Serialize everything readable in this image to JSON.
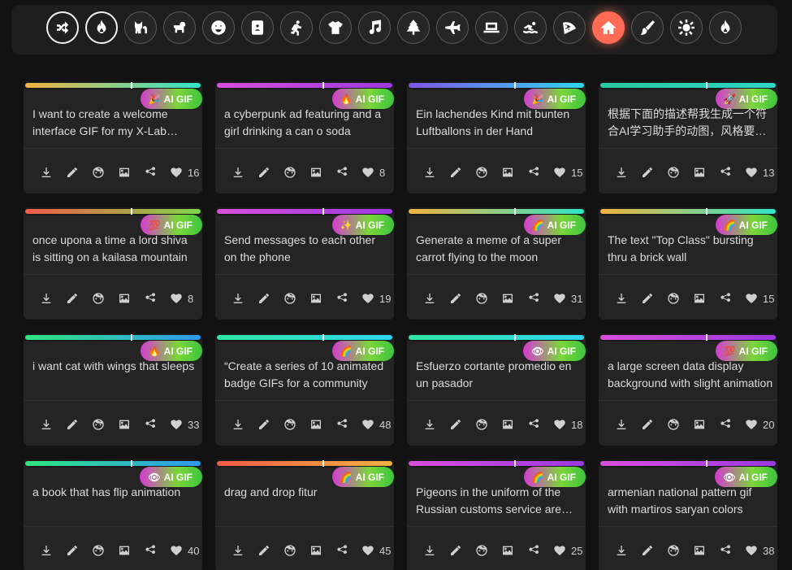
{
  "categories": [
    {
      "icon": "shuffle-icon",
      "state": "selected"
    },
    {
      "icon": "fire-icon",
      "state": "selected"
    },
    {
      "icon": "cat-icon",
      "state": ""
    },
    {
      "icon": "dog-icon",
      "state": ""
    },
    {
      "icon": "smiley-icon",
      "state": ""
    },
    {
      "icon": "contact-card-icon",
      "state": ""
    },
    {
      "icon": "running-person-icon",
      "state": ""
    },
    {
      "icon": "tshirt-icon",
      "state": ""
    },
    {
      "icon": "music-note-icon",
      "state": ""
    },
    {
      "icon": "tree-icon",
      "state": ""
    },
    {
      "icon": "airplane-icon",
      "state": ""
    },
    {
      "icon": "laptop-icon",
      "state": ""
    },
    {
      "icon": "swimmer-icon",
      "state": ""
    },
    {
      "icon": "pizza-icon",
      "state": ""
    },
    {
      "icon": "home-icon",
      "state": "active"
    },
    {
      "icon": "paintbrush-icon",
      "state": ""
    },
    {
      "icon": "sun-icon",
      "state": ""
    },
    {
      "icon": "flame-icon",
      "state": ""
    }
  ],
  "badge_label": "AI GIF",
  "cards": [
    {
      "text": "I want to create a welcome interface GIF for my X-Lab website",
      "emoji": "🎉",
      "count": "16",
      "bar": [
        "#f2b340",
        "#2ee6c9"
      ]
    },
    {
      "text": "a cyberpunk ad featuring and a girl drinking a can o soda",
      "emoji": "🔥",
      "count": "8",
      "bar": [
        "#d94fdc",
        "#9b39e0"
      ]
    },
    {
      "text": "Ein lachendes Kind mit bunten Luftballons in der Hand",
      "emoji": "🎉",
      "count": "15",
      "bar": [
        "#7f54e8",
        "#2ed6f0"
      ]
    },
    {
      "text": "根据下面的描述帮我生成一个符合AI学习助手的动图，风格要求简洁",
      "emoji": "🚀",
      "count": "13",
      "bar": [
        "#27c9a0",
        "#2ed6c6"
      ]
    },
    {
      "text": "once upona a time a lord shiva is sitting on a kailasa mountain",
      "emoji": "💯",
      "count": "8",
      "bar": [
        "#f25a48",
        "#7fd64a"
      ]
    },
    {
      "text": "Send messages to each other on the phone",
      "emoji": "✨",
      "count": "19",
      "bar": [
        "#d94fdc",
        "#9b39e0"
      ]
    },
    {
      "text": "Generate a meme of a super carrot flying to the moon",
      "emoji": "🌈",
      "count": "31",
      "bar": [
        "#f2b340",
        "#2ee6c9"
      ]
    },
    {
      "text": "The text \"Top Class\" bursting thru a brick wall",
      "emoji": "🌈",
      "count": "15",
      "bar": [
        "#f2b340",
        "#2ee6c9"
      ]
    },
    {
      "text": "i want cat with wings that sleeps",
      "emoji": "🔥",
      "count": "33",
      "bar": [
        "#2ee67f",
        "#2e9af0"
      ]
    },
    {
      "text": "“Create a series of 10 animated badge GIFs for a community",
      "emoji": "🌈",
      "count": "48",
      "bar": [
        "#2ee6a0",
        "#2ed6f0"
      ]
    },
    {
      "text": "Esfuerzo cortante promedio en un pasador",
      "emoji": "👁",
      "count": "18",
      "bar": [
        "#2ee6a0",
        "#2ed6f0"
      ]
    },
    {
      "text": "a large screen data display background with slight animation",
      "emoji": "💯",
      "count": "20",
      "bar": [
        "#d94fdc",
        "#9b39e0"
      ]
    },
    {
      "text": "a book that has flip animation",
      "emoji": "👁",
      "count": "40",
      "bar": [
        "#2ee67f",
        "#2e9af0"
      ]
    },
    {
      "text": "drag and drop fitur",
      "emoji": "🌈",
      "count": "45",
      "bar": [
        "#f25a48",
        "#f2b340"
      ]
    },
    {
      "text": "Pigeons in the uniform of the Russian customs service are flying",
      "emoji": "🌈",
      "count": "25",
      "bar": [
        "#d94fdc",
        "#9b39e0"
      ],
      "tall": true
    },
    {
      "text": "armenian national pattern gif with martiros saryan colors",
      "emoji": "👁",
      "count": "38",
      "bar": [
        "#d94fdc",
        "#9b39e0"
      ],
      "tall": true
    }
  ],
  "colors": {
    "accent": "#ff6b55",
    "card": "#242424",
    "page": "#121212"
  }
}
